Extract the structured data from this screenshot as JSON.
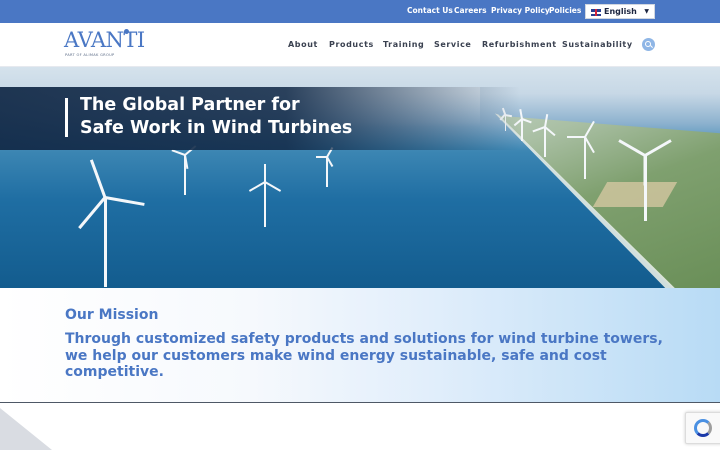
{
  "topbar": {
    "links": [
      "Contact Us",
      "Careers",
      "Privacy Policy",
      "Policies"
    ],
    "language": "English"
  },
  "brand": {
    "logo_text": "AVANTI",
    "logo_subtext": "PART OF ALIMAK GROUP"
  },
  "nav": {
    "items": [
      "About",
      "Products",
      "Training",
      "Service",
      "Refurbishment",
      "Sustainability"
    ]
  },
  "hero": {
    "title_line1": "The Global Partner for",
    "title_line2": "Safe Work in Wind Turbines"
  },
  "mission": {
    "heading": "Our Mission",
    "text": "Through customized safety products and solutions for wind turbine towers, we help our customers make wind energy sustainable, safe and cost competitive."
  },
  "colors": {
    "brand_blue": "#4a77c4",
    "hero_band": "#122a48",
    "white": "#ffffff"
  },
  "icons": [
    "uk-flag-icon",
    "chevron-down-icon",
    "search-icon",
    "recaptcha-icon"
  ]
}
